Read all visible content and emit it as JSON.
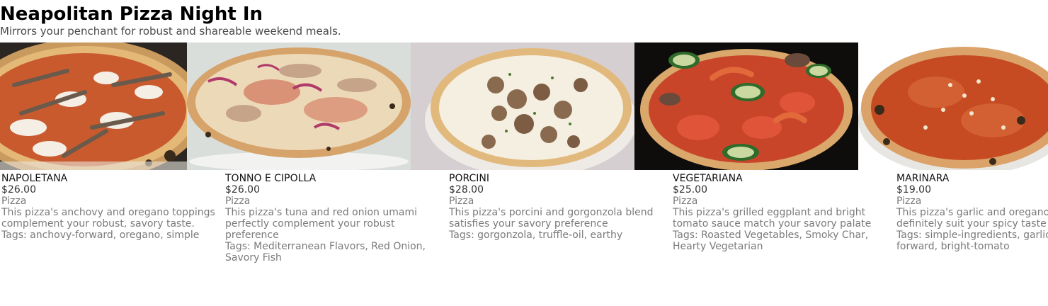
{
  "header": {
    "title": "Neapolitan Pizza Night In",
    "subtitle": "Mirrors your penchant for robust and shareable weekend meals."
  },
  "items": [
    {
      "name": "NAPOLETANA",
      "price": "$26.00",
      "category": "Pizza",
      "description": "This pizza's anchovy and oregano toppings complement your robust, savory taste.",
      "tags": "Tags: anchovy-forward, oregano, simple"
    },
    {
      "name": "TONNO E CIPOLLA",
      "price": "$26.00",
      "category": "Pizza",
      "description": "This pizza's tuna and red onion umami perfectly complement your robust preference",
      "tags": "Tags: Mediterranean Flavors, Red Onion, Savory Fish"
    },
    {
      "name": "PORCINI",
      "price": "$28.00",
      "category": "Pizza",
      "description": "This pizza's porcini and gorgonzola blend satisfies your savory preference",
      "tags": "Tags: gorgonzola, truffle-oil, earthy"
    },
    {
      "name": "VEGETARIANA",
      "price": "$25.00",
      "category": "Pizza",
      "description": "This pizza's grilled eggplant and bright tomato sauce match your savory palate",
      "tags": "Tags: Roasted Vegetables, Smoky Char, Hearty Vegetarian"
    },
    {
      "name": "MARINARA",
      "price": "$19.00",
      "category": "Pizza",
      "description": "This pizza's garlic and oregano definitely suit your spicy taste",
      "tags": "Tags: simple-ingredients, garlic-forward, bright-tomato"
    }
  ],
  "colors": {
    "crust": "#e8c48a",
    "char": "#3a2a1a",
    "sauce": "#d0451f",
    "cheese": "#f6efe2"
  }
}
